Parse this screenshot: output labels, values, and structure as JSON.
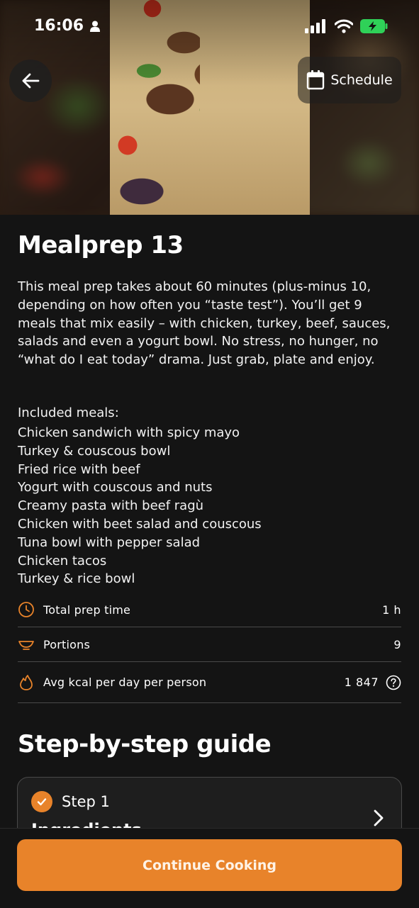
{
  "status_bar": {
    "time": "16:06"
  },
  "header": {
    "schedule_label": "Schedule"
  },
  "recipe": {
    "title": "Mealprep 13",
    "description": "This meal prep takes about 60 minutes (plus-minus 10, depending on how often you “taste test”). You’ll get 9 meals that mix easily – with chicken, turkey, beef, sauces, salads and even a yogurt bowl. No stress, no hunger, no “what do I eat today” drama. Just grab, plate and enjoy.",
    "included_heading": "Included meals:",
    "meals": [
      "Chicken sandwich with spicy mayo",
      "Turkey & couscous bowl",
      "Fried rice with beef",
      "Yogurt with couscous and nuts",
      "Creamy pasta with beef ragù",
      "Chicken with beet salad and couscous",
      "Tuna bowl with pepper salad",
      "Chicken tacos",
      "Turkey & rice bowl"
    ]
  },
  "stats": [
    {
      "label": "Total prep time",
      "value": "1 h",
      "icon": "clock-icon"
    },
    {
      "label": "Portions",
      "value": "9",
      "icon": "bowl-icon"
    },
    {
      "label": "Avg kcal per day per person",
      "value": "1 847",
      "icon": "flame-icon"
    }
  ],
  "guide": {
    "title": "Step-by-step guide",
    "steps": [
      {
        "label": "Step 1",
        "subtitle": "Ingredients",
        "completed": true
      }
    ]
  },
  "footer": {
    "continue_label": "Continue Cooking"
  },
  "colors": {
    "accent": "#e8832a",
    "background": "#141414",
    "divider": "#4a4a4a"
  }
}
